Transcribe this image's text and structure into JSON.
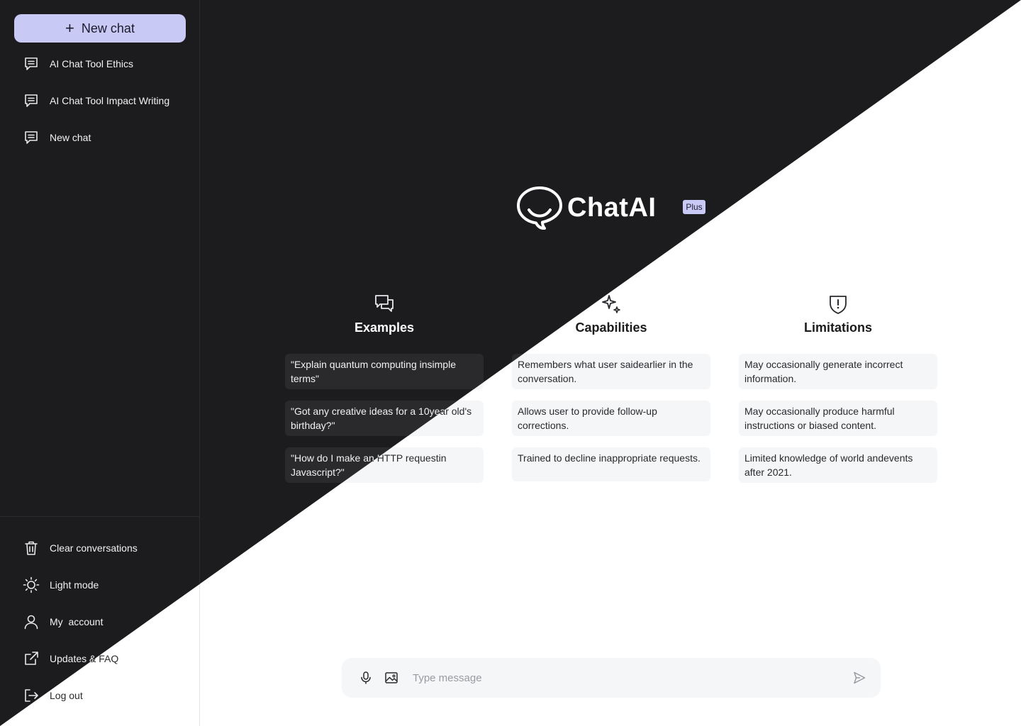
{
  "sidebar": {
    "new_chat_label": "New chat",
    "history": [
      {
        "label": "AI Chat Tool Ethics"
      },
      {
        "label": "AI Chat Tool Impact Writing"
      },
      {
        "label": "New chat"
      }
    ],
    "bottom": {
      "clear": "Clear conversations",
      "light_mode": "Light mode",
      "account": "My  account",
      "updates": "Updates & FAQ",
      "logout": "Log out"
    }
  },
  "brand": {
    "name": "ChatAI",
    "badge": "Plus",
    "accent": "#c9c9f6",
    "dark_bg": "#1c1c1e",
    "light_bg": "#ffffff"
  },
  "columns": {
    "examples": {
      "title": "Examples",
      "icon": "chat-bubbles-icon",
      "items": [
        "\"Explain quantum computing insimple terms\"",
        "\"Got any creative ideas for a 10year old's birthday?\"",
        "\"How do I make an HTTP requestin Javascript?\""
      ]
    },
    "capabilities": {
      "title": "Capabilities",
      "icon": "sparkles-icon",
      "items": [
        "Remembers what user saidearlier in the conversation.",
        "Allows user to provide follow-up corrections.",
        "Trained to decline inappropriate requests."
      ]
    },
    "limitations": {
      "title": "Limitations",
      "icon": "shield-alert-icon",
      "items": [
        "May occasionally generate incorrect information.",
        "May occasionally produce harmful instructions or biased content.",
        "Limited knowledge of world andevents after 2021."
      ]
    }
  },
  "composer": {
    "placeholder": "Type message",
    "icons": [
      "microphone-icon",
      "image-icon",
      "send-icon"
    ]
  }
}
